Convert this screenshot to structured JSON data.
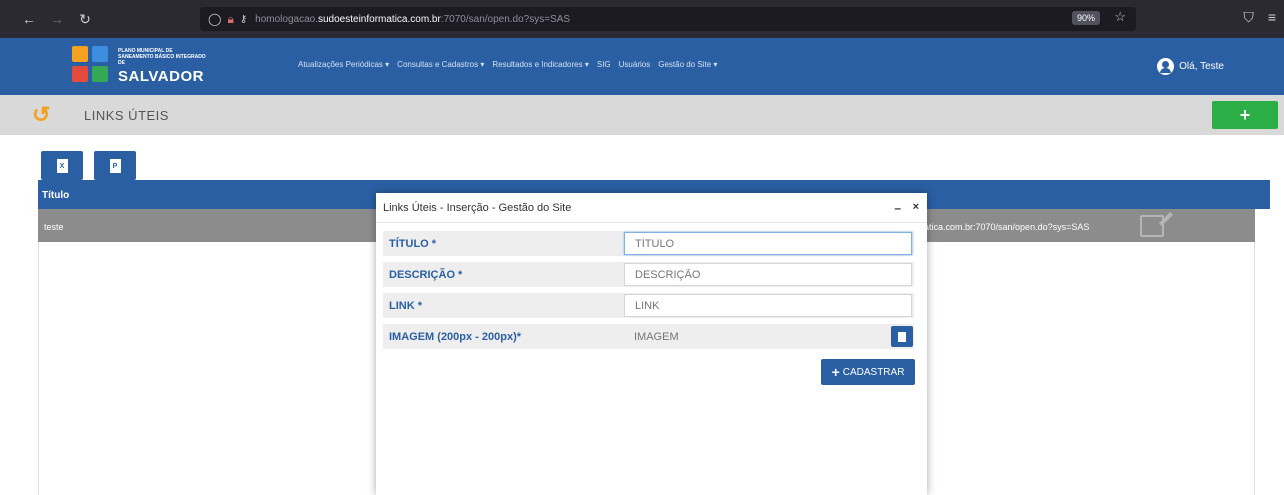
{
  "browser": {
    "url_prefix": "homologacao.",
    "url_domain": "sudoesteinformatica.com.br",
    "url_suffix": ":7070/san/open.do?sys=SAS",
    "zoom": "90%"
  },
  "header": {
    "logo_small": "PLANO MUNICIPAL DE SANEAMENTO BÁSICO INTEGRADO DE",
    "logo_big": "SALVADOR",
    "menu": [
      "Atualizações Periódicas ▾",
      "Consultas e Cadastros ▾",
      "Resultados e Indicadores ▾",
      "SIG",
      "Usuários",
      "Gestão do Site ▾"
    ],
    "user_greeting": "Olá, Teste"
  },
  "page": {
    "title": "LINKS ÚTEIS",
    "add_label": "+"
  },
  "exports": {
    "excel_glyph": "X",
    "pdf_glyph": "P"
  },
  "table": {
    "col_title": "Título",
    "rows": [
      {
        "title": "teste",
        "link": "atica.com.br:7070/san/open.do?sys=SAS"
      }
    ]
  },
  "modal": {
    "title": "Links Úteis - Inserção - Gestão do Site",
    "min_label": "–",
    "close_label": "×",
    "fields": [
      {
        "label": "TÍTULO *",
        "placeholder": "TÍTULO"
      },
      {
        "label": "DESCRIÇÃO *",
        "placeholder": "DESCRIÇÃO"
      },
      {
        "label": "LINK *",
        "placeholder": "LINK"
      },
      {
        "label": "IMAGEM (200px - 200px)*",
        "placeholder": "IMAGEM"
      }
    ],
    "submit_icon": "+",
    "submit_label": "CADASTRAR"
  },
  "colors": {
    "primary": "#2a5fa3",
    "success": "#2bae45",
    "back_icon": "#f4a11f"
  }
}
